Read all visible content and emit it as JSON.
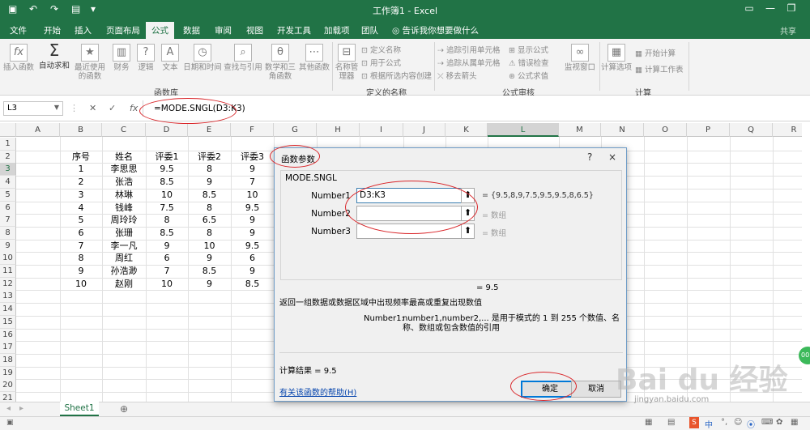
{
  "titlebar": {
    "title": "工作簿1 - Excel"
  },
  "tabs": [
    "文件",
    "开始",
    "插入",
    "页面布局",
    "公式",
    "数据",
    "审阅",
    "视图",
    "开发工具",
    "加载项",
    "团队"
  ],
  "active_tab": "公式",
  "tell_me": "告诉我你想要做什么",
  "share": "共享",
  "ribbon": {
    "insert_function": "插入函数",
    "autosum": "自动求和",
    "recently_used": "最近使用的函数",
    "financial": "财务",
    "logical": "逻辑",
    "text": "文本",
    "date_time": "日期和时间",
    "lookup": "查找与引用",
    "math": "数学和三角函数",
    "more": "其他函数",
    "group_library": "函数库",
    "name_manager": "名称管理器",
    "define_name": "定义名称",
    "use_in_formula": "用于公式",
    "create_from_selection": "根据所选内容创建",
    "group_names": "定义的名称",
    "trace_precedents": "追踪引用单元格",
    "trace_dependents": "追踪从属单元格",
    "remove_arrows": "移去箭头",
    "show_formulas": "显示公式",
    "error_checking": "错误检查",
    "evaluate_formula": "公式求值",
    "group_audit": "公式审核",
    "watch_window": "监视窗口",
    "calc_options": "计算选项",
    "calc_now": "开始计算",
    "calc_sheet": "计算工作表",
    "group_calc": "计算"
  },
  "formula_bar": {
    "name_box": "L3",
    "formula": "=MODE.SNGL(D3:K3)"
  },
  "columns": [
    "A",
    "B",
    "C",
    "D",
    "E",
    "F",
    "G",
    "H",
    "I",
    "J",
    "K",
    "L",
    "M",
    "N",
    "O",
    "P",
    "Q",
    "R"
  ],
  "rows": [
    "1",
    "2",
    "3",
    "4",
    "5",
    "6",
    "7",
    "8",
    "9",
    "10",
    "11",
    "12",
    "13",
    "14",
    "15",
    "16",
    "17",
    "18",
    "19",
    "20",
    "21"
  ],
  "table": {
    "headers": [
      "序号",
      "姓名",
      "评委1",
      "评委2",
      "评委3"
    ],
    "data": [
      [
        "1",
        "李思思",
        "9.5",
        "8",
        "9"
      ],
      [
        "2",
        "张浩",
        "8.5",
        "9",
        "7"
      ],
      [
        "3",
        "林琳",
        "10",
        "8.5",
        "10"
      ],
      [
        "4",
        "钱峰",
        "7.5",
        "8",
        "9.5"
      ],
      [
        "5",
        "周玲玲",
        "8",
        "6.5",
        "9"
      ],
      [
        "6",
        "张珊",
        "8.5",
        "8",
        "9"
      ],
      [
        "7",
        "李一凡",
        "9",
        "10",
        "9.5"
      ],
      [
        "8",
        "周红",
        "6",
        "9",
        "6"
      ],
      [
        "9",
        "孙浩渺",
        "7",
        "8.5",
        "9"
      ],
      [
        "10",
        "赵刚",
        "10",
        "9",
        "8.5"
      ]
    ]
  },
  "sheet_tab": "Sheet1",
  "dialog": {
    "title": "函数参数",
    "help_btn": "?",
    "close_btn": "×",
    "function_name": "MODE.SNGL",
    "args": [
      {
        "label": "Number1",
        "value": "D3:K3",
        "result": "= {9.5,8,9,7.5,9.5,9.5,8,6.5}"
      },
      {
        "label": "Number2",
        "value": "",
        "result": "= 数组"
      },
      {
        "label": "Number3",
        "value": "",
        "result": "= 数组"
      }
    ],
    "equals_value": "= 9.5",
    "description": "返回一组数据或数据区域中出现频率最高或重复出现数值",
    "param_name": "Number1:",
    "param_desc": "number1,number2,... 是用于模式的 1 到 255 个数值、名称、数组或包含数值的引用",
    "result": "计算结果 = 9.5",
    "help_link": "有关该函数的帮助(H)",
    "ok": "确定",
    "cancel": "取消"
  },
  "watermark": {
    "brand": "Bai du 经验",
    "url": "jingyan.baidu.com"
  },
  "colors": {
    "excel_green": "#217346",
    "annotation_red": "#d9262a"
  }
}
